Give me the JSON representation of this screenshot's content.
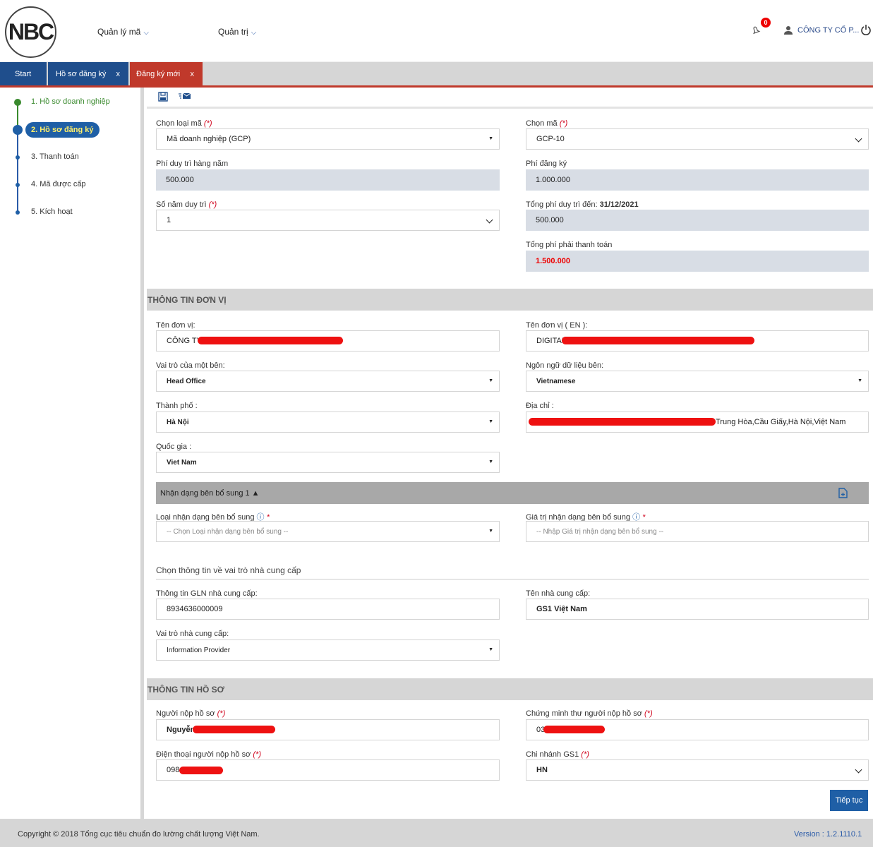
{
  "header": {
    "logo": "NBC",
    "nav": [
      "Quản lý mã",
      "Quản trị"
    ],
    "notification_count": "0",
    "user_name": "CÔNG TY CỔ P..."
  },
  "tabs": [
    "Start",
    "Hồ sơ đăng ký",
    "Đăng ký mới"
  ],
  "tab_close": "x",
  "steps": [
    "1. Hồ sơ doanh nghiệp",
    "2. Hồ sơ đăng ký",
    "3. Thanh toán",
    "4. Mã được cấp",
    "5. Kích hoạt"
  ],
  "form": {
    "code_type_label": "Chọn loại mã",
    "code_type_value": "Mã doanh nghiệp (GCP)",
    "code_label": "Chọn mã",
    "code_value": "GCP-10",
    "annual_fee_label": "Phí duy trì hàng năm",
    "annual_fee_value": "500.000",
    "reg_fee_label": "Phí đăng ký",
    "reg_fee_value": "1.000.000",
    "years_label": "Số năm duy trì",
    "years_value": "1",
    "total_maint_label": "Tổng phí duy trì đến:",
    "total_maint_date": "31/12/2021",
    "total_maint_value": "500.000",
    "total_pay_label": "Tổng phí phải thanh toán",
    "total_pay_value": "1.500.000",
    "required_mark": "(*)",
    "star": "*"
  },
  "unit": {
    "section_title": "THÔNG TIN ĐƠN VỊ",
    "name_label": "Tên đơn vị:",
    "name_value": "CÔNG TY",
    "name_en_label": "Tên đơn vị ( EN ):",
    "name_en_value": "DIGITAL",
    "role_label": "Vai trò của một bên:",
    "role_value": "Head Office",
    "lang_label": "Ngôn ngữ dữ liệu bên:",
    "lang_value": "Vietnamese",
    "city_label": "Thành phố :",
    "city_value": "Hà Nội",
    "address_label": "Địa chỉ :",
    "address_value": "Trung Hòa,Cầu Giấy,Hà Nội,Việt Nam",
    "country_label": "Quốc gia :",
    "country_value": "Viet Nam",
    "extra_id_title": "Nhận dạng bên bổ sung 1 ▲",
    "extra_type_label": "Loại nhận dạng bên bổ sung",
    "extra_type_placeholder": "-- Chọn Loại nhận dạng bên bổ sung --",
    "extra_value_label": "Giá trị nhận dạng bên bổ sung",
    "extra_value_placeholder": "-- Nhập Giá trị nhận dạng bên bổ sung --",
    "provider_heading": "Chọn thông tin về vai trò nhà cung cấp",
    "gln_label": "Thông tin GLN nhà cung cấp:",
    "gln_value": "8934636000009",
    "provider_name_label": "Tên nhà cung cấp:",
    "provider_name_value": "GS1 Việt Nam",
    "provider_role_label": "Vai trò nhà cung cấp:",
    "provider_role_value": "Information Provider"
  },
  "dossier": {
    "section_title": "THÔNG TIN HỒ SƠ",
    "submitter_label": "Người nộp hồ sơ",
    "submitter_value": "Nguyễn",
    "id_label": "Chứng minh thư người nộp hồ sơ",
    "id_value": "03",
    "phone_label": "Điện thoại người nộp hồ sơ",
    "phone_value": "098",
    "branch_label": "Chi nhánh GS1",
    "branch_value": "HN",
    "continue_label": "Tiếp tục"
  },
  "footer": {
    "copyright": "Copyright © 2018 Tổng cục tiêu chuẩn đo lường chất lượng Việt Nam.",
    "version": "Version : 1.2.1110.1"
  },
  "colors": {
    "primary": "#1f5fa6",
    "tab_active": "#c0392b",
    "done_green": "#3a8a2e",
    "redact": "#e11111"
  }
}
